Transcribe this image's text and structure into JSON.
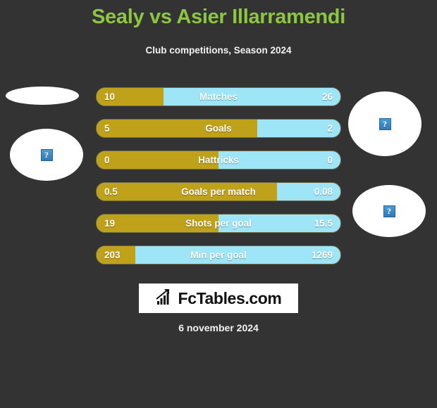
{
  "header": {
    "title": "Sealy vs Asier Illarramendi",
    "subtitle": "Club competitions, Season 2024"
  },
  "colors": {
    "background": "#333333",
    "title": "#8DC63F",
    "player_left": "#BFA11A",
    "player_right": "#9EE5F7",
    "text": "#FFFFFF"
  },
  "placeholders": [
    {
      "name": "left-photo-top",
      "icon": "broken-image-icon",
      "glyph": "?"
    },
    {
      "name": "left-photo-bottom",
      "icon": "broken-image-icon",
      "glyph": "?"
    },
    {
      "name": "right-photo-top",
      "icon": "broken-image-icon",
      "glyph": "?"
    },
    {
      "name": "right-photo-bottom",
      "icon": "broken-image-icon",
      "glyph": "?"
    }
  ],
  "logo": {
    "text": "FcTables.com",
    "icon": "bar-chart-growth-icon"
  },
  "footer": {
    "date": "6 november 2024"
  },
  "chart_data": {
    "type": "bar",
    "title": "Sealy vs Asier Illarramendi",
    "subtitle": "Club competitions, Season 2024",
    "orientation": "horizontal-diverging",
    "series": [
      {
        "name": "Sealy",
        "color": "#BFA11A",
        "side": "left"
      },
      {
        "name": "Asier Illarramendi",
        "color": "#9EE5F7",
        "side": "right"
      }
    ],
    "categories": [
      "Matches",
      "Goals",
      "Hattricks",
      "Goals per match",
      "Shots per goal",
      "Min per goal"
    ],
    "rows": [
      {
        "label": "Matches",
        "left_value": "10",
        "right_value": "26",
        "left_pct": 27.5
      },
      {
        "label": "Goals",
        "left_value": "5",
        "right_value": "2",
        "left_pct": 66.0
      },
      {
        "label": "Hattricks",
        "left_value": "0",
        "right_value": "0",
        "left_pct": 50.0
      },
      {
        "label": "Goals per match",
        "left_value": "0.5",
        "right_value": "0.08",
        "left_pct": 74.0
      },
      {
        "label": "Shots per goal",
        "left_value": "19",
        "right_value": "15.5",
        "left_pct": 50.0
      },
      {
        "label": "Min per goal",
        "left_value": "203",
        "right_value": "1269",
        "left_pct": 16.0
      }
    ]
  }
}
